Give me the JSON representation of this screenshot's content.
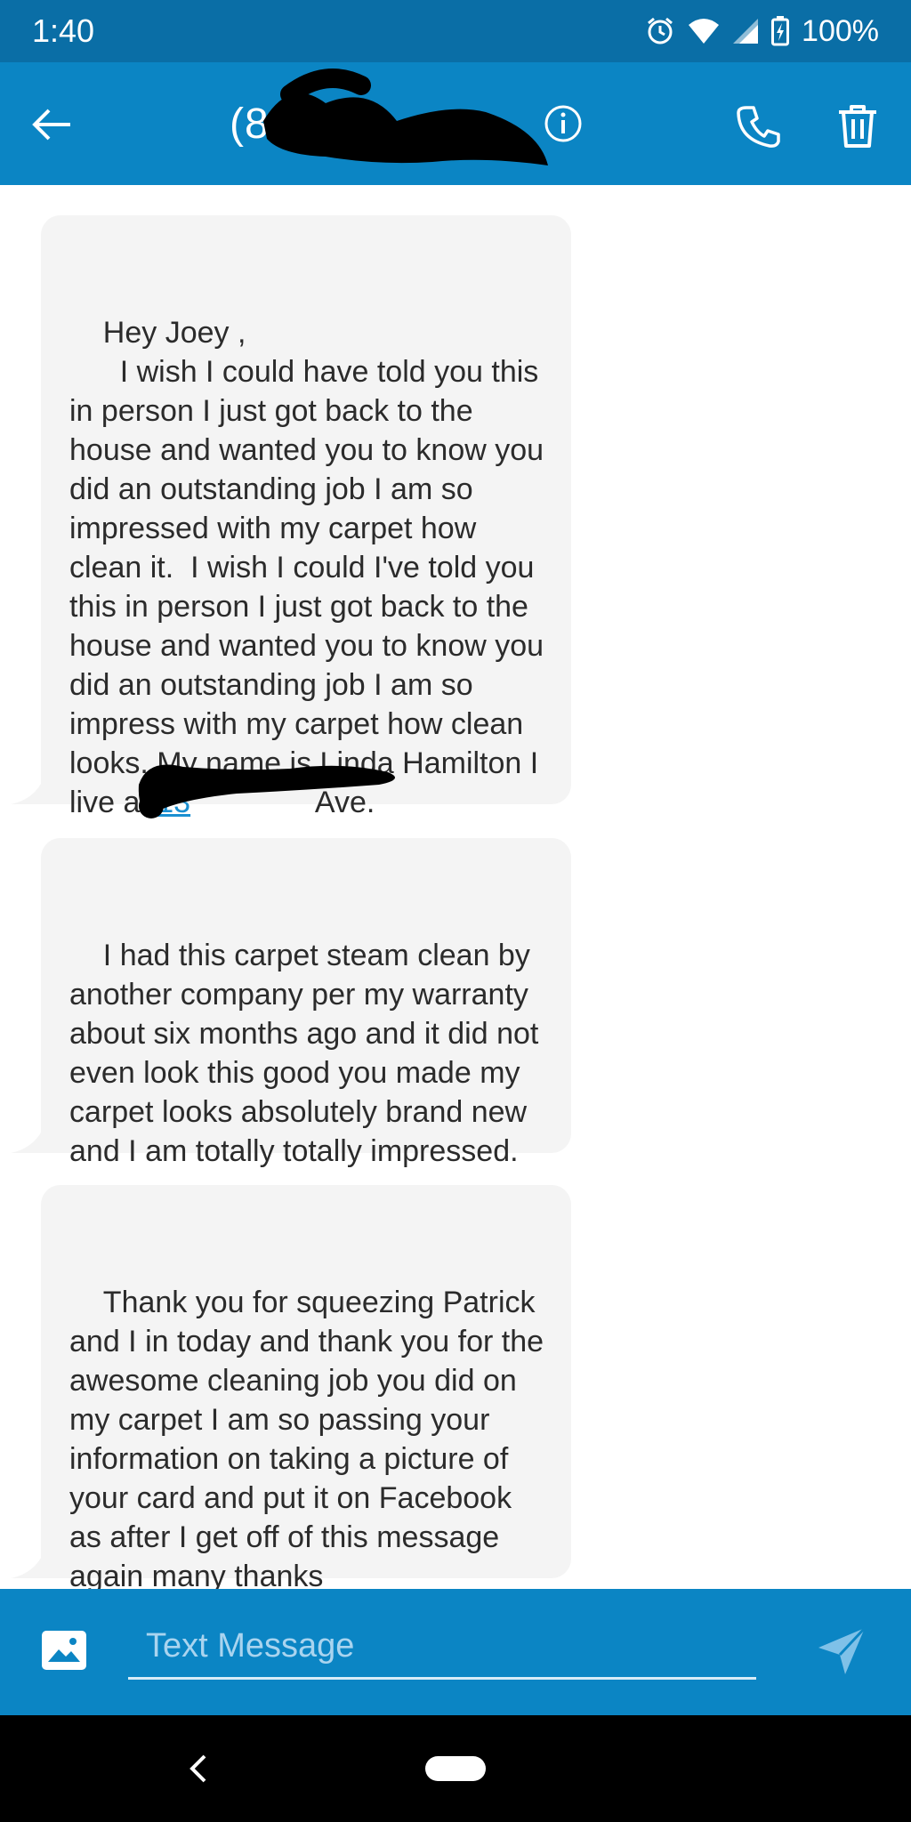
{
  "status_bar": {
    "time": "1:40",
    "battery": "100%",
    "icons": [
      "alarm-icon",
      "wifi-icon",
      "signal-icon",
      "battery-charging-icon"
    ]
  },
  "header": {
    "contact_title": "(8          2",
    "icons": [
      "back-arrow-icon",
      "info-icon",
      "phone-icon",
      "trash-icon"
    ],
    "color": "#0b85c4"
  },
  "messages": [
    {
      "text_before_link": "Hey Joey ,\n      I wish I could have told you this in person I just got back to the house and wanted you to know you did an outstanding job I am so impressed with my carpet how clean it.  I wish I could I've told you this in person I just got back to the house and wanted you to know you did an outstanding job I am so impress with my carpet how clean looks. My name is Linda Hamilton I live at ",
      "link_text": "13",
      "text_after_link": "               Ave."
    },
    {
      "text": "I had this carpet steam clean by another company per my warranty about six months ago and it did not even look this good you made my carpet looks absolutely brand new and I am totally totally impressed."
    },
    {
      "text": "Thank you for squeezing Patrick and I in today and thank you for the awesome cleaning job you did on my carpet I am so passing your information on taking a picture of your card and put it on Facebook as after I get off of this message again many thanks"
    }
  ],
  "composer": {
    "placeholder": "Text Message",
    "icons": [
      "image-icon",
      "send-icon"
    ]
  },
  "nav": {
    "icons": [
      "nav-back-icon",
      "nav-home-pill"
    ]
  },
  "colors": {
    "status_bar": "#0a6ea6",
    "app_bar": "#0b85c4",
    "bubble": "#f4f4f4",
    "link": "#1a8fd1"
  }
}
